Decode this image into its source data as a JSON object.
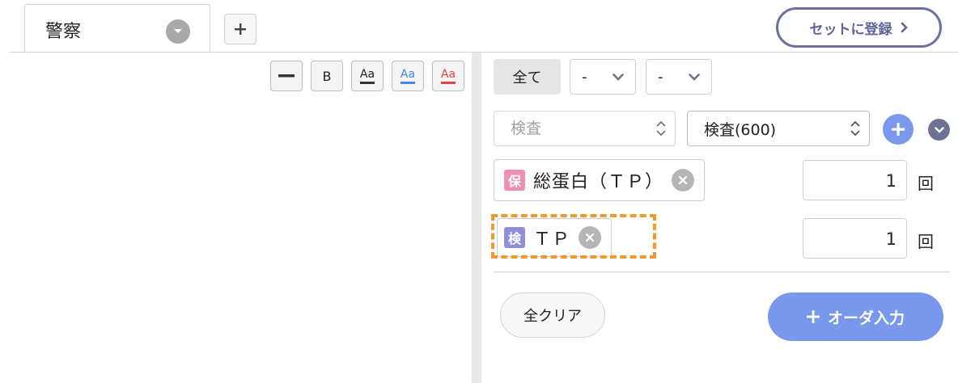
{
  "tabs": [
    {
      "label": "警察"
    }
  ],
  "header": {
    "register_button": "セットに登録"
  },
  "editor_toolbar": {
    "bold": "B",
    "text_style_label": "Aa",
    "colors": {
      "black": "#333333",
      "blue": "#3f87ea",
      "red": "#e8414b"
    }
  },
  "filters": {
    "all_button": "全て",
    "select1": "-",
    "select2": "-"
  },
  "search": {
    "placeholder": "検査",
    "combo_value": "検査(600)"
  },
  "items": [
    {
      "tag": "保",
      "tag_color": "#ef8fb3",
      "label": "総蛋白（ＴＰ）",
      "quantity": "1",
      "unit": "回"
    },
    {
      "tag": "検",
      "tag_color": "#8f8fd9",
      "label": "ＴＰ",
      "quantity": "1",
      "unit": "回"
    }
  ],
  "actions": {
    "clear_all": "全クリア",
    "order_input": "オーダ入力"
  },
  "colors": {
    "accent": "#7898eb",
    "highlight": "#f2992e",
    "register_border": "#6b72a2"
  }
}
